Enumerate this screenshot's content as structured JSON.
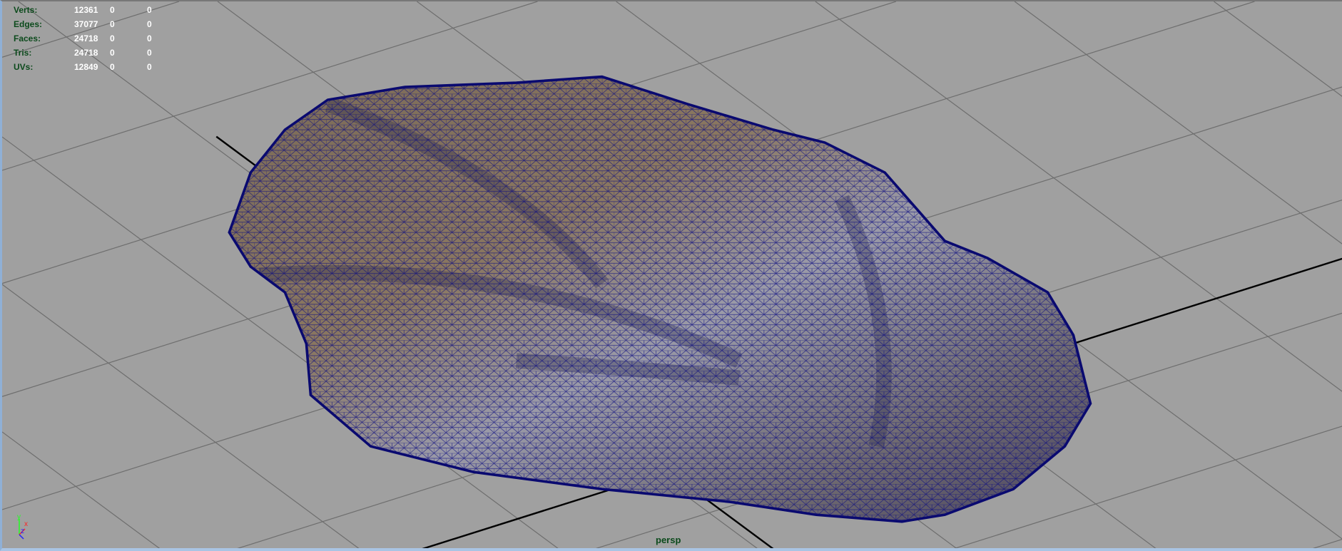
{
  "hud": {
    "rows": [
      {
        "label": "Verts:",
        "value": "12361",
        "sel": "0",
        "extra": "0"
      },
      {
        "label": "Edges:",
        "value": "37077",
        "sel": "0",
        "extra": "0"
      },
      {
        "label": "Faces:",
        "value": "24718",
        "sel": "0",
        "extra": "0"
      },
      {
        "label": "Tris:",
        "value": "24718",
        "sel": "0",
        "extra": "0"
      },
      {
        "label": "UVs:",
        "value": "12849",
        "sel": "0",
        "extra": "0"
      }
    ]
  },
  "camera_label": "persp",
  "axis_labels": {
    "y": "y",
    "x": "x",
    "z": "z"
  },
  "colors": {
    "background": "#a0a0a0",
    "wire": "#0a0a80",
    "hud_label": "#0c4a1c"
  }
}
